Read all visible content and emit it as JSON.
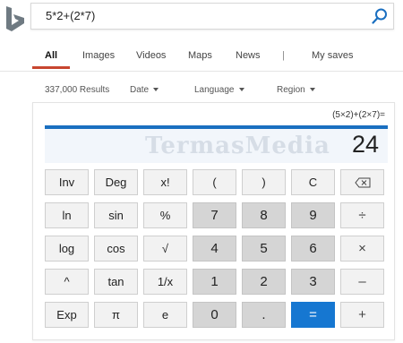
{
  "search": {
    "query": "5*2+(2*7)"
  },
  "nav": {
    "items": [
      {
        "label": "All",
        "active": true
      },
      {
        "label": "Images"
      },
      {
        "label": "Videos"
      },
      {
        "label": "Maps"
      },
      {
        "label": "News"
      },
      {
        "label": "|"
      },
      {
        "label": "My saves"
      }
    ]
  },
  "filters": {
    "results": "337,000 Results",
    "date": "Date",
    "language": "Language",
    "region": "Region"
  },
  "calculator": {
    "expression": "(5×2)+(2×7)=",
    "result": "24",
    "watermark": "TermasMedia",
    "rows": [
      [
        {
          "label": "Inv"
        },
        {
          "label": "Deg"
        },
        {
          "label": "x!"
        },
        {
          "label": "("
        },
        {
          "label": ")"
        },
        {
          "label": "C"
        },
        {
          "label": "⌫",
          "icon": "backspace-icon"
        }
      ],
      [
        {
          "label": "ln"
        },
        {
          "label": "sin"
        },
        {
          "label": "%"
        },
        {
          "label": "7"
        },
        {
          "label": "8"
        },
        {
          "label": "9"
        },
        {
          "label": "÷"
        }
      ],
      [
        {
          "label": "log"
        },
        {
          "label": "cos"
        },
        {
          "label": "√"
        },
        {
          "label": "4"
        },
        {
          "label": "5"
        },
        {
          "label": "6"
        },
        {
          "label": "×"
        }
      ],
      [
        {
          "label": "^"
        },
        {
          "label": "tan"
        },
        {
          "label": "1/x"
        },
        {
          "label": "1"
        },
        {
          "label": "2"
        },
        {
          "label": "3"
        },
        {
          "label": "–"
        }
      ],
      [
        {
          "label": "Exp"
        },
        {
          "label": "π"
        },
        {
          "label": "e"
        },
        {
          "label": "0"
        },
        {
          "label": "."
        },
        {
          "label": "="
        },
        {
          "label": "+"
        }
      ]
    ]
  },
  "colors": {
    "accent": "#1a6fc0",
    "equals": "#1677d1",
    "nav_underline": "#c8462f"
  }
}
